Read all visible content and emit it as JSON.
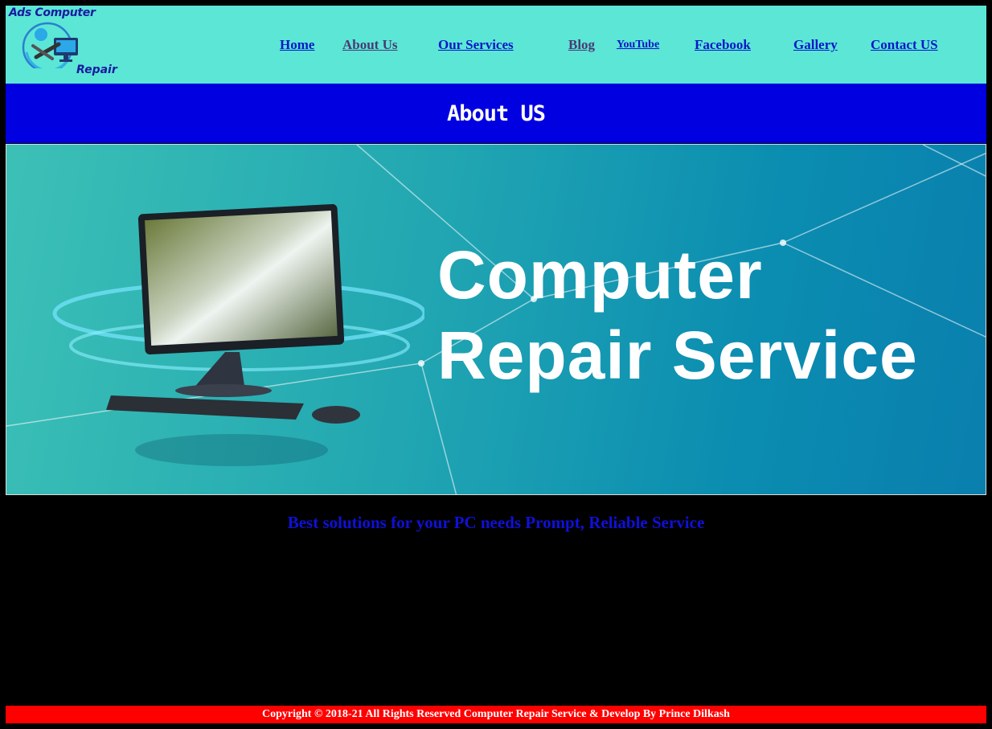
{
  "logo": {
    "line1": "Ads Computer",
    "line2": "Repair",
    "icon": "computer-repair-logo-icon"
  },
  "nav": [
    {
      "label": "Home"
    },
    {
      "label": "About Us"
    },
    {
      "label": "Our Services"
    },
    {
      "label": "Blog"
    },
    {
      "label": "YouTube"
    },
    {
      "label": "Facebook"
    },
    {
      "label": "Gallery"
    },
    {
      "label": "Contact US"
    }
  ],
  "page_title": "About US",
  "banner": {
    "line1": "Computer",
    "line2": "Repair Service"
  },
  "tagline": "Best solutions for your PC needs Prompt, Reliable Service",
  "footer": "Copyright © 2018-21 All Rights Reserved Computer Repair Service & Develop By Prince Dilkash",
  "colors": {
    "header_bg": "#5be6d6",
    "title_bar_bg": "#0000e0",
    "footer_bg": "#ff0000",
    "link": "#0b16c9",
    "page_bg": "#000000"
  }
}
